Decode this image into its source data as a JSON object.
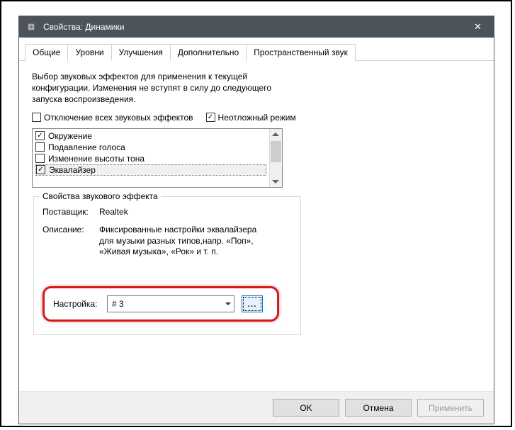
{
  "window": {
    "title": "Свойства: Динамики",
    "close_glyph": "✕"
  },
  "tabs": {
    "general": "Общие",
    "levels": "Уровни",
    "enhancements": "Улучшения",
    "advanced": "Дополнительно",
    "spatial": "Пространственный звук"
  },
  "body": {
    "description": "Выбор звуковых эффектов для применения к текущей конфигурации. Изменения не вступят в силу до следующего запуска воспроизведения.",
    "disable_all_label": "Отключение всех звуковых эффектов",
    "immediate_label": "Неотложный режим",
    "check_glyph": "✓",
    "effects": {
      "surround": "Окружение",
      "voice_cancel": "Подавление голоса",
      "pitch_shift": "Изменение высоты тона",
      "equalizer": "Эквалайзер"
    },
    "group": {
      "title": "Свойства звукового эффекта",
      "provider_label": "Поставщик:",
      "provider_value": "Realtek",
      "desc_label": "Описание:",
      "desc_value": "Фиксированные настройки эквалайзера для музыки разных типов,напр. «Поп», «Живая музыка», «Рок» и т. п."
    },
    "setting_label": "Настройка:",
    "setting_value": "# 3",
    "dots_label": "..."
  },
  "footer": {
    "ok": "OK",
    "cancel": "Отмена",
    "apply": "Применить"
  }
}
